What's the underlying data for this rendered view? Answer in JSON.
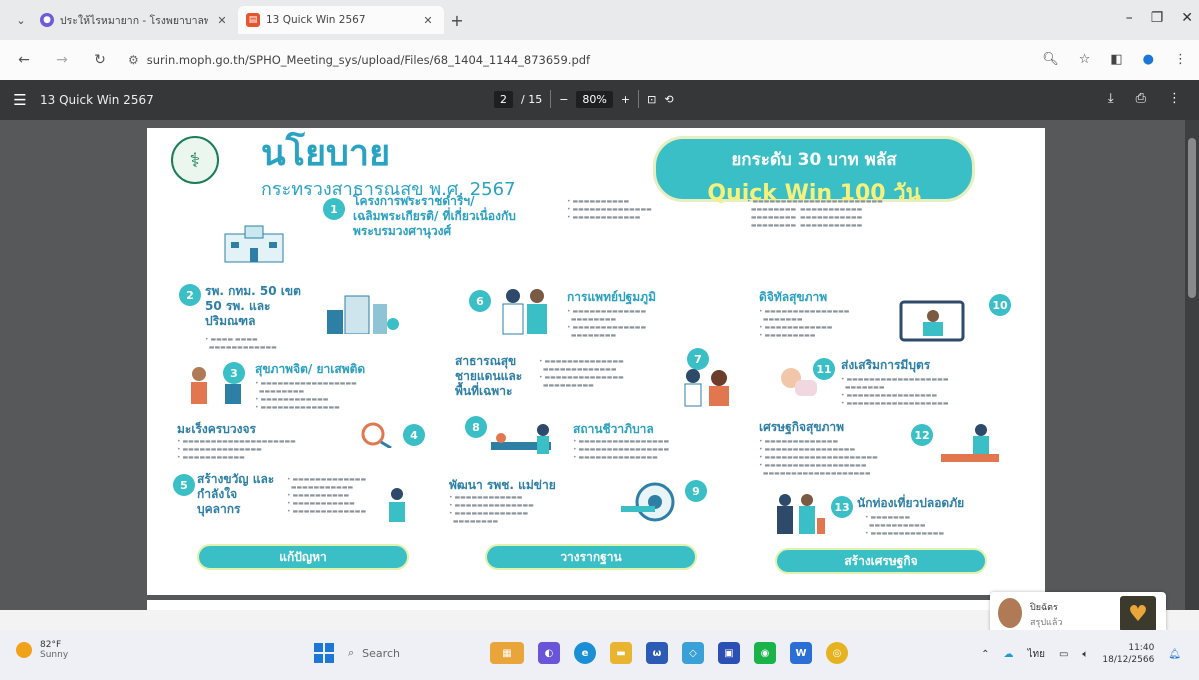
{
  "browser": {
    "tabs": [
      {
        "title": "ประให้ไรหมายาก - โรงพยาบาลพ...",
        "active": false
      },
      {
        "title": "13 Quick Win 2567",
        "active": true
      }
    ],
    "url": "surin.moph.go.th/SPHO_Meeting_sys/upload/Files/68_1404_1144_873659.pdf"
  },
  "pdf_toolbar": {
    "title": "13 Quick Win 2567",
    "page_current": "2",
    "page_total": "/ 15",
    "zoom": "80%"
  },
  "slide": {
    "title": "นโยบาย",
    "subtitle": "กระทรวงสาธารณสุข พ.ศ. 2567",
    "banner_line1": "ยกระดับ 30 บาท พลัส",
    "banner_line2": "Quick Win 100 วัน",
    "items": [
      {
        "num": "1",
        "heading": "โครงการพระราชดำริฯ/ เฉลิมพระเกียรติ/ ที่เกี่ยวเนื่องกับ พระบรมวงศานุวงศ์"
      },
      {
        "num": "2",
        "heading": "รพ. กทม. 50 เขต 50 รพ. และปริมณฑล"
      },
      {
        "num": "3",
        "heading": "สุขภาพจิต/ ยาเสพติด"
      },
      {
        "num": "4",
        "heading": "มะเร็งครบวงจร"
      },
      {
        "num": "5",
        "heading": "สร้างขวัญ และกำลังใจ บุคลากร"
      },
      {
        "num": "6",
        "heading": "การแพทย์ปฐมภูมิ"
      },
      {
        "num": "7",
        "heading": "สาธารณสุข ชายแดนและ พื้นที่เฉพาะ"
      },
      {
        "num": "8",
        "heading": "สถานชีวาภิบาล"
      },
      {
        "num": "9",
        "heading": "พัฒนา รพช. แม่ข่าย"
      },
      {
        "num": "10",
        "heading": "ดิจิทัลสุขภาพ"
      },
      {
        "num": "11",
        "heading": "ส่งเสริมการมีบุตร"
      },
      {
        "num": "12",
        "heading": "เศรษฐกิจสุขภาพ"
      },
      {
        "num": "13",
        "heading": "นักท่องเที่ยวปลอดภัย"
      }
    ],
    "pills": [
      "แก้ปัญหา",
      "วางรากฐาน",
      "สร้างเศรษฐกิจ"
    ]
  },
  "notification": {
    "name": "ปิยฉัตร",
    "message": "สรุปแล้ว"
  },
  "taskbar": {
    "temp": "82°F",
    "weather": "Sunny",
    "search": "Search",
    "lang": "ไทย",
    "time": "11:40",
    "date": "18/12/2566"
  },
  "colors": {
    "accent": "#3bbfc6",
    "title_blue": "#2aa3c3",
    "banner_yellow": "#f6f07d"
  }
}
